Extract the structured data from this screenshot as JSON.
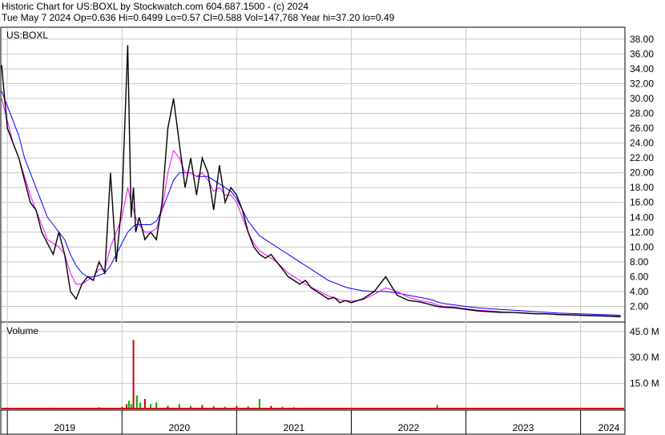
{
  "header": {
    "line1": "Historic Chart for US:BOXL by Stockwatch.com 604.687.1500 - (c) 2024",
    "line2": "Tue May  7 2024  Op=0.636  Hi=0.6499  Lo=0.57  Cl=0.588  Vol=147,768  Year hi=37.20  lo=0.49"
  },
  "colors": {
    "price": "#000000",
    "ma_short": "#ff00ff",
    "ma_long": "#0000ff",
    "volume_up": "#00aa00",
    "volume_down": "#cc0000",
    "grid": "#c8c8c8"
  },
  "chart_data": [
    {
      "type": "line",
      "title": "US:BOXL",
      "y_ticks": [
        "38.00",
        "36.00",
        "34.00",
        "32.00",
        "30.00",
        "28.00",
        "26.00",
        "24.00",
        "22.00",
        "20.00",
        "18.00",
        "16.00",
        "14.00",
        "12.00",
        "10.00",
        "8.00",
        "6.00",
        "4.00",
        "2.00"
      ],
      "ylim": [
        0,
        39.5
      ],
      "x_labels": [
        "2019",
        "2020",
        "2021",
        "2022",
        "2023",
        "2024"
      ],
      "grid": true,
      "x": [
        2018.95,
        2019.0,
        2019.05,
        2019.1,
        2019.15,
        2019.2,
        2019.25,
        2019.3,
        2019.35,
        2019.4,
        2019.45,
        2019.5,
        2019.55,
        2019.6,
        2019.65,
        2019.7,
        2019.75,
        2019.8,
        2019.85,
        2019.9,
        2019.95,
        2020.0,
        2020.05,
        2020.08,
        2020.1,
        2020.12,
        2020.15,
        2020.2,
        2020.25,
        2020.3,
        2020.35,
        2020.4,
        2020.45,
        2020.5,
        2020.55,
        2020.6,
        2020.65,
        2020.7,
        2020.75,
        2020.8,
        2020.85,
        2020.9,
        2020.95,
        2021.0,
        2021.05,
        2021.1,
        2021.15,
        2021.2,
        2021.25,
        2021.3,
        2021.35,
        2021.4,
        2021.45,
        2021.5,
        2021.55,
        2021.6,
        2021.65,
        2021.7,
        2021.75,
        2021.8,
        2021.85,
        2021.9,
        2021.95,
        2022.0,
        2022.1,
        2022.2,
        2022.3,
        2022.4,
        2022.5,
        2022.6,
        2022.7,
        2022.75,
        2022.8,
        2022.9,
        2023.0,
        2023.1,
        2023.2,
        2023.3,
        2023.4,
        2023.5,
        2023.6,
        2023.7,
        2023.8,
        2023.9,
        2024.0,
        2024.1,
        2024.2,
        2024.3,
        2024.35
      ],
      "series": [
        {
          "values": [
            34.5,
            26,
            24,
            22,
            19,
            16,
            15,
            12,
            10.5,
            9,
            12,
            9,
            4,
            3,
            5,
            6,
            5.5,
            8,
            6.5,
            20,
            8,
            16,
            37.2,
            14,
            18,
            12,
            14,
            11,
            12,
            11,
            16,
            26,
            30,
            24,
            18,
            22,
            17,
            22,
            20,
            15,
            21,
            16,
            18,
            17,
            15,
            12,
            10,
            9,
            8.5,
            9,
            8,
            7,
            6,
            5.5,
            5,
            5.5,
            4.5,
            4,
            3.5,
            3,
            3.2,
            2.5,
            2.8,
            2.5,
            3,
            4,
            6,
            3.5,
            2.8,
            2.6,
            2.2,
            2.0,
            1.9,
            1.8,
            1.6,
            1.4,
            1.3,
            1.2,
            1.2,
            1.1,
            1.0,
            1.0,
            0.9,
            0.85,
            0.8,
            0.75,
            0.7,
            0.65,
            0.59
          ]
        },
        {
          "values": [
            30,
            27,
            24,
            22,
            19.5,
            17,
            15,
            13,
            11,
            10.5,
            10,
            9,
            6.5,
            5,
            5,
            5.5,
            6,
            7,
            7,
            10,
            12,
            14,
            18,
            16,
            15,
            14,
            13,
            12,
            12,
            12.5,
            15,
            20,
            23,
            22,
            20,
            20,
            19.5,
            20,
            19,
            17.5,
            18,
            17,
            17,
            16,
            14,
            12,
            10.5,
            9.5,
            9,
            8.5,
            8,
            7.2,
            6.5,
            6,
            5.5,
            5,
            4.6,
            4.2,
            3.8,
            3.4,
            3.2,
            2.9,
            2.8,
            2.7,
            2.9,
            3.6,
            4.5,
            4,
            3.2,
            2.8,
            2.5,
            2.2,
            2.0,
            1.9,
            1.7,
            1.5,
            1.4,
            1.3,
            1.2,
            1.15,
            1.05,
            1.0,
            0.95,
            0.9,
            0.85,
            0.8,
            0.75,
            0.7,
            0.65
          ]
        },
        {
          "values": [
            31,
            29,
            27,
            25,
            22,
            20,
            18,
            16,
            14,
            13,
            12,
            11,
            9,
            7.5,
            6.5,
            6,
            6,
            6.2,
            6.5,
            7.5,
            9,
            10.5,
            12,
            12.5,
            12.8,
            13,
            13,
            13,
            13,
            13.5,
            15,
            17,
            19,
            20,
            20,
            20,
            19.5,
            19.5,
            19.5,
            19,
            18.5,
            18,
            17.5,
            16.5,
            15,
            13.5,
            12.5,
            11.5,
            11,
            10.5,
            10,
            9.5,
            9,
            8.5,
            8,
            7.5,
            7,
            6.5,
            6,
            5.5,
            5.2,
            4.9,
            4.6,
            4.4,
            4.1,
            4.0,
            4.0,
            3.8,
            3.5,
            3.2,
            2.9,
            2.6,
            2.4,
            2.2,
            2.0,
            1.8,
            1.7,
            1.6,
            1.5,
            1.4,
            1.3,
            1.2,
            1.1,
            1.05,
            1.0,
            0.95,
            0.9,
            0.85,
            0.8
          ]
        }
      ]
    },
    {
      "type": "bar",
      "title": "Volume",
      "y_ticks": [
        "45.0 M",
        "30.0 M",
        "15.0 M"
      ],
      "ylim": [
        0,
        50
      ],
      "x": [
        2019.0,
        2019.2,
        2019.4,
        2019.6,
        2019.8,
        2020.0,
        2020.04,
        2020.06,
        2020.08,
        2020.1,
        2020.13,
        2020.16,
        2020.2,
        2020.25,
        2020.3,
        2020.4,
        2020.5,
        2020.6,
        2020.7,
        2020.8,
        2020.9,
        2021.0,
        2021.1,
        2021.2,
        2021.3,
        2021.4,
        2021.5,
        2021.6,
        2021.7,
        2021.8,
        2021.9,
        2022.0,
        2022.2,
        2022.4,
        2022.6,
        2022.75,
        2022.9,
        2023.0,
        2023.2,
        2023.4,
        2023.6,
        2023.8,
        2024.0,
        2024.2,
        2024.35
      ],
      "values": [
        1,
        0.8,
        1,
        0.8,
        1.2,
        1.5,
        3,
        5,
        3,
        40,
        8,
        4,
        6,
        3,
        4,
        2,
        3,
        2,
        2.5,
        2,
        1.5,
        2,
        1.8,
        6,
        2,
        1.5,
        1.2,
        1,
        1,
        0.8,
        0.8,
        0.8,
        0.7,
        0.6,
        0.6,
        2.5,
        0.6,
        0.5,
        0.5,
        0.4,
        0.4,
        0.4,
        0.4,
        0.3,
        0.3
      ]
    }
  ]
}
